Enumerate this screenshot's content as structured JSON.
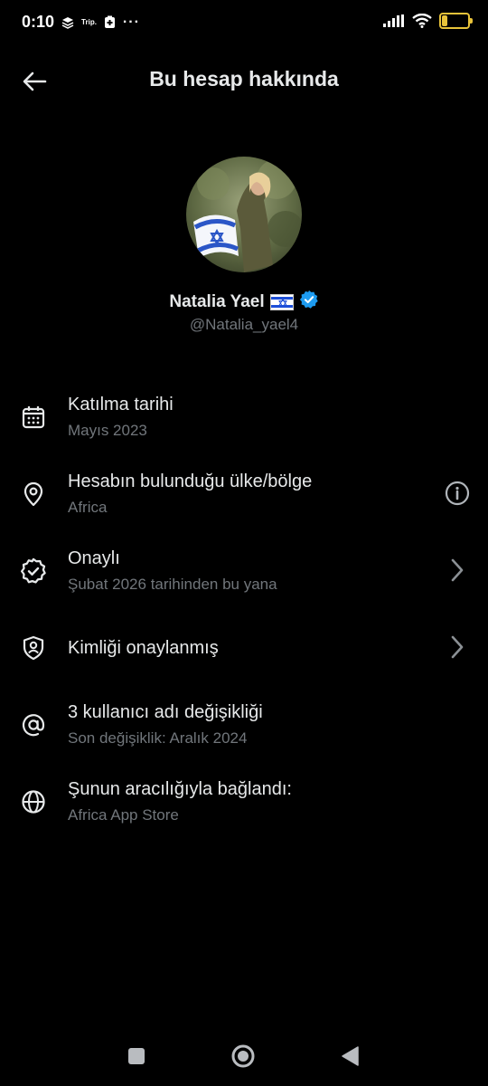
{
  "status_bar": {
    "time": "0:10",
    "trip_label": "Trip.",
    "more_dots": "···",
    "battery_level": "21",
    "battery_color": "#e8c33a"
  },
  "header": {
    "back_icon": "arrow-left-icon",
    "title": "Bu hesap hakkında"
  },
  "profile": {
    "display_name": "Natalia Yael",
    "flag_icon": "israel-flag-icon",
    "verified_icon": "verified-badge-icon",
    "verified_color": "#1d9bf0",
    "handle": "@Natalia_yael4"
  },
  "rows": [
    {
      "icon": "calendar-icon",
      "title": "Katılma tarihi",
      "subtitle": "Mayıs 2023",
      "trailing": ""
    },
    {
      "icon": "location-pin-icon",
      "title": "Hesabın bulunduğu ülke/bölge",
      "subtitle": "Africa",
      "trailing": "info-icon"
    },
    {
      "icon": "verified-outline-icon",
      "title": "Onaylı",
      "subtitle": "Şubat 2026 tarihinden bu yana",
      "trailing": "chevron-right-icon"
    },
    {
      "icon": "id-shield-icon",
      "title": "Kimliği onaylanmış",
      "subtitle": "",
      "trailing": "chevron-right-icon"
    },
    {
      "icon": "at-sign-icon",
      "title": "3 kullanıcı adı değişikliği",
      "subtitle": "Son değişiklik: Aralık 2024",
      "trailing": ""
    },
    {
      "icon": "globe-icon",
      "title": "Şunun aracılığıyla bağlandı:",
      "subtitle": "Africa App Store",
      "trailing": ""
    }
  ],
  "navbar": {
    "recents_icon": "square-icon",
    "home_icon": "circle-icon",
    "back_icon": "triangle-back-icon"
  }
}
